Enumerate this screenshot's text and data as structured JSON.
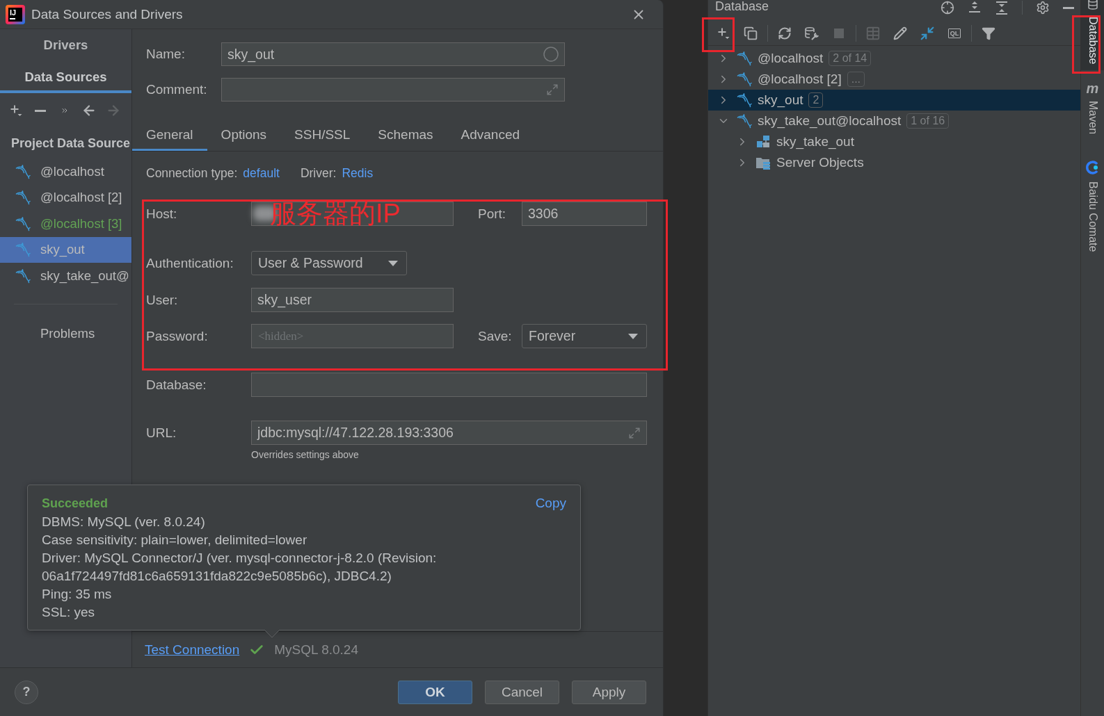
{
  "window": {
    "title": "Data Sources and Drivers",
    "logo_text": "IJ"
  },
  "sidebar": {
    "tabs": [
      {
        "label": "Drivers",
        "selected": false
      },
      {
        "label": "Data Sources",
        "selected": true
      }
    ],
    "toolbar": [
      {
        "kind": "add",
        "disabled": false
      },
      {
        "kind": "remove",
        "disabled": false
      },
      {
        "kind": "more",
        "disabled": false
      },
      {
        "kind": "back",
        "disabled": false
      },
      {
        "kind": "forward",
        "disabled": true
      }
    ],
    "section_title": "Project Data Source",
    "items": [
      {
        "label": "@localhost",
        "selected": false,
        "changed": false
      },
      {
        "label": "@localhost [2]",
        "selected": false,
        "changed": false
      },
      {
        "label": "@localhost [3]",
        "selected": false,
        "changed": true
      },
      {
        "label": "sky_out",
        "selected": true,
        "changed": false
      },
      {
        "label": "sky_take_out@",
        "selected": false,
        "changed": false
      }
    ],
    "problems": "Problems"
  },
  "name": {
    "label": "Name:",
    "value": "sky_out"
  },
  "comment": {
    "label": "Comment:"
  },
  "tabs": [
    {
      "label": "General",
      "selected": true
    },
    {
      "label": "Options",
      "selected": false
    },
    {
      "label": "SSH/SSL",
      "selected": false
    },
    {
      "label": "Schemas",
      "selected": false
    },
    {
      "label": "Advanced",
      "selected": false
    }
  ],
  "connection": {
    "type_label": "Connection type:",
    "type_value": "default",
    "driver_label": "Driver:",
    "driver_value": "Redis"
  },
  "general": {
    "host": {
      "label": "Host:",
      "annotation": "服务器的IP"
    },
    "port": {
      "label": "Port:",
      "value": "3306"
    },
    "authentication": {
      "label": "Authentication:",
      "value": "User & Password"
    },
    "user": {
      "label": "User:",
      "value": "sky_user"
    },
    "password": {
      "label": "Password:",
      "placeholder": "<hidden>"
    },
    "save": {
      "label": "Save:",
      "value": "Forever"
    },
    "database": {
      "label": "Database:"
    },
    "url": {
      "label": "URL:",
      "value": "jdbc:mysql://47.122.28.193:3306",
      "hint": "Overrides settings above"
    }
  },
  "test_result": {
    "status": "Succeeded",
    "copy": "Copy",
    "lines": [
      "DBMS: MySQL (ver. 8.0.24)",
      "Case sensitivity: plain=lower, delimited=lower",
      "Driver: MySQL Connector/J (ver. mysql-connector-j-8.2.0 (Revision: 06a1f724497fd81c6a659131fda822c9e5085b6c), JDBC4.2)",
      "Ping: 35 ms",
      "SSL: yes"
    ]
  },
  "test_bar": {
    "link": "Test Connection",
    "ok": true,
    "version": "MySQL 8.0.24"
  },
  "footer": {
    "help": "?",
    "buttons": [
      {
        "label": "OK",
        "default": true
      },
      {
        "label": "Cancel",
        "default": false
      },
      {
        "label": "Apply",
        "default": false
      }
    ]
  },
  "database_panel": {
    "title": "Database",
    "toolbar": [
      [
        {
          "kind": "add",
          "disabled": false
        },
        {
          "kind": "copy",
          "disabled": false
        }
      ],
      [
        {
          "kind": "refresh",
          "disabled": false
        },
        {
          "kind": "properties",
          "disabled": false
        },
        {
          "kind": "stop",
          "disabled": true
        }
      ],
      [
        {
          "kind": "table",
          "disabled": true
        },
        {
          "kind": "edit",
          "disabled": false
        },
        {
          "kind": "jump",
          "disabled": false
        },
        {
          "kind": "console",
          "label": "QL",
          "disabled": false
        }
      ],
      [
        {
          "kind": "filter",
          "disabled": false
        }
      ]
    ],
    "tree": [
      {
        "label": "@localhost",
        "badge": "2 of 14",
        "kind": "datasource",
        "expanded": false,
        "selected": false
      },
      {
        "label": "@localhost [2]",
        "badge": "...",
        "kind": "datasource",
        "expanded": false,
        "selected": false
      },
      {
        "label": "sky_out",
        "badge": "2",
        "kind": "datasource",
        "expanded": false,
        "selected": true
      },
      {
        "label": "sky_take_out@localhost",
        "badge": "1 of 16",
        "kind": "datasource",
        "expanded": true,
        "selected": false,
        "children": [
          {
            "label": "sky_take_out",
            "kind": "schema",
            "expanded": false,
            "selected": false
          },
          {
            "label": "Server Objects",
            "kind": "folder",
            "expanded": false,
            "selected": false
          }
        ]
      }
    ]
  },
  "tool_strip": [
    {
      "label": "Database",
      "kind": "database",
      "selected": true
    },
    {
      "label": "Maven",
      "kind": "maven",
      "glyph": "m",
      "selected": false
    },
    {
      "label": "Baidu Comate",
      "kind": "comate",
      "selected": false
    }
  ]
}
